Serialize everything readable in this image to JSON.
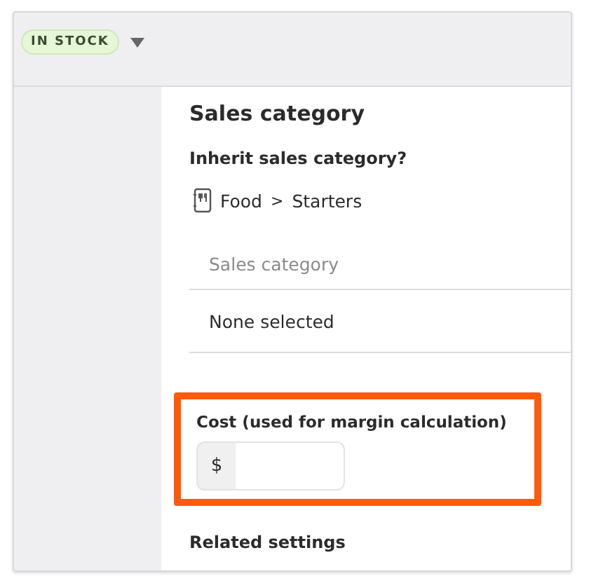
{
  "header": {
    "badge": "IN STOCK"
  },
  "section": {
    "title": "Sales category",
    "inherit_label": "Inherit sales category?",
    "breadcrumb": [
      "Food",
      "Starters"
    ],
    "breadcrumb_separator": ">",
    "category_field": {
      "placeholder": "Sales category",
      "value": "None selected"
    }
  },
  "cost": {
    "label": "Cost (used for margin calculation)",
    "prefix": "$",
    "highlighted": true
  },
  "related_heading": "Related settings"
}
